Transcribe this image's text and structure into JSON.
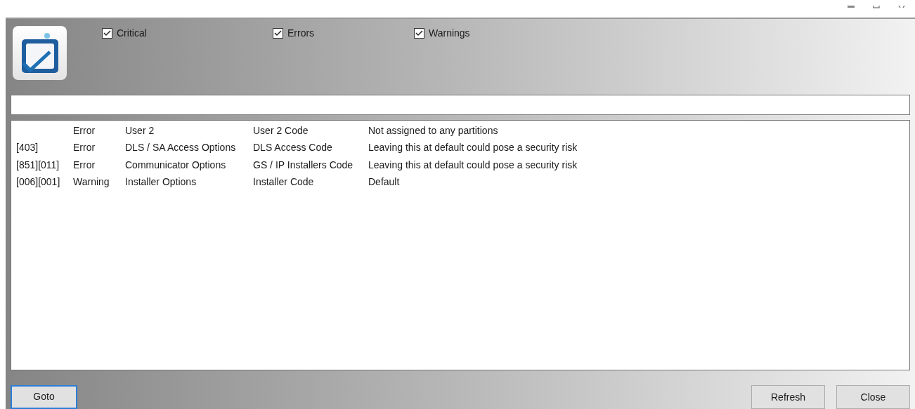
{
  "filters": [
    {
      "label": "Critical",
      "checked": true
    },
    {
      "label": "Errors",
      "checked": true
    },
    {
      "label": "Warnings",
      "checked": true
    }
  ],
  "table": {
    "rows": [
      {
        "cells": [
          "",
          "Error",
          "User 2",
          "User 2 Code",
          "Not assigned to any partitions"
        ]
      },
      {
        "cells": [
          "[403]",
          "Error",
          "DLS / SA Access Options",
          "DLS Access Code",
          "Leaving this at default could pose a security risk"
        ]
      },
      {
        "cells": [
          "[851][011]",
          "Error",
          "Communicator Options",
          "GS / IP Installers Code",
          "Leaving this at default could pose a security risk"
        ]
      },
      {
        "cells": [
          "[006][001]",
          "Warning",
          "Installer Options",
          "Installer Code",
          "Default"
        ]
      }
    ]
  },
  "buttons": {
    "left": [
      "Goto"
    ],
    "right": [
      "Refresh",
      "Close"
    ]
  }
}
